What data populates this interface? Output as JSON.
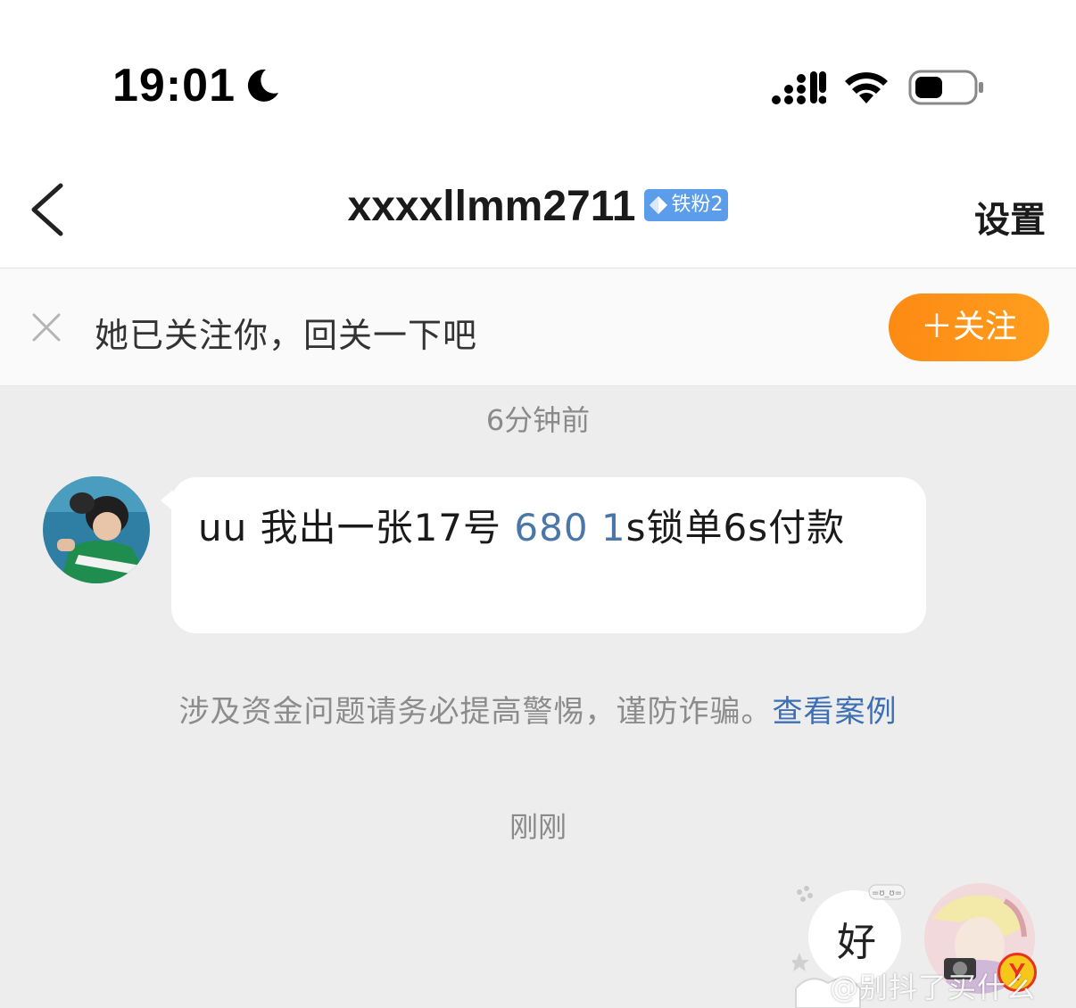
{
  "status_bar": {
    "time": "19:01",
    "icons": [
      "moon-icon",
      "signal-icon",
      "wifi-icon",
      "battery-icon"
    ]
  },
  "nav": {
    "title": "xxxxllmm2711",
    "fan_badge": "铁粉2",
    "settings_label": "设置"
  },
  "follow_banner": {
    "text": "她已关注你，回关一下吧",
    "button_label": "＋关注"
  },
  "chat": {
    "timestamp_1": "6分钟前",
    "incoming_message": {
      "part1": "uu 我出一张17号 ",
      "highlight": "680 1",
      "part2": "s锁单6s付款"
    },
    "warning_text": "涉及资金问题请务必提高警惕，谨防诈骗。",
    "warning_link": "查看案例",
    "timestamp_2": "刚刚",
    "outgoing_message": "好",
    "vip_badge": "Y"
  },
  "watermark": "@别抖了买什么",
  "colors": {
    "follow_button": "#fd8a13",
    "badge_blue": "#5b9dea",
    "link_blue": "#3d6fb3",
    "highlight_blue": "#4a77a8",
    "chat_background": "#ededed"
  }
}
